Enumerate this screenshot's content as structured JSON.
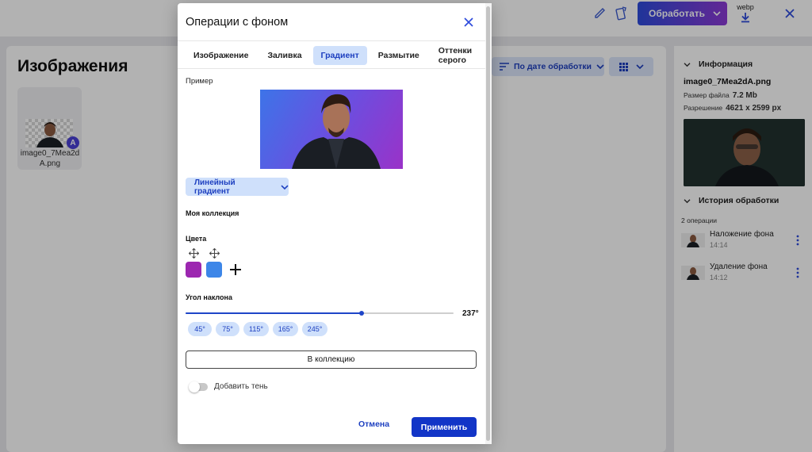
{
  "topbar": {
    "process_label": "Обработать",
    "format_label": "webp",
    "icons": [
      "pencil-icon",
      "cards-icon",
      "chevron-down-icon",
      "download-icon",
      "close-icon"
    ]
  },
  "main": {
    "title": "Изображения",
    "sort_label": "По дате обработки",
    "files": [
      {
        "name": "image0_7Mea2dA.png",
        "badge": "A"
      }
    ]
  },
  "sidebar": {
    "info_title": "Информация",
    "file_name": "image0_7Mea2dA.png",
    "size_label": "Размер файла",
    "size_value": "7.2 Mb",
    "resolution_label": "Разрешение",
    "resolution_value": "4621 x 2599 px",
    "history_title": "История обработки",
    "ops_count": "2 операции",
    "history": [
      {
        "title": "Наложение фона",
        "time": "14:14"
      },
      {
        "title": "Удаление фона",
        "time": "14:12"
      }
    ]
  },
  "dialog": {
    "title": "Операции с фоном",
    "tabs": [
      {
        "label": "Изображение",
        "active": false
      },
      {
        "label": "Заливка",
        "active": false
      },
      {
        "label": "Градиент",
        "active": true
      },
      {
        "label": "Размытие",
        "active": false
      },
      {
        "label": "Оттенки серого",
        "active": false
      }
    ],
    "example_label": "Пример",
    "gradient_type": "Линейный градиент",
    "collection_label": "Моя коллекция",
    "colors_label": "Цвета",
    "colors": [
      "#9c27b0",
      "#3d86e8"
    ],
    "angle_label": "Угол наклона",
    "angle_value": "237°",
    "angle_fraction": 0.658,
    "presets": [
      "45°",
      "75°",
      "115°",
      "165°",
      "245°"
    ],
    "add_collection": "В коллекцию",
    "shadow_label": "Добавить тень",
    "shadow_on": false,
    "cancel": "Отмена",
    "apply": "Применить"
  },
  "colors": {
    "accent": "#1235c7",
    "accent_light": "#cfe0fb",
    "gradient_start": "#3d74e8",
    "gradient_end": "#9a32c8"
  }
}
